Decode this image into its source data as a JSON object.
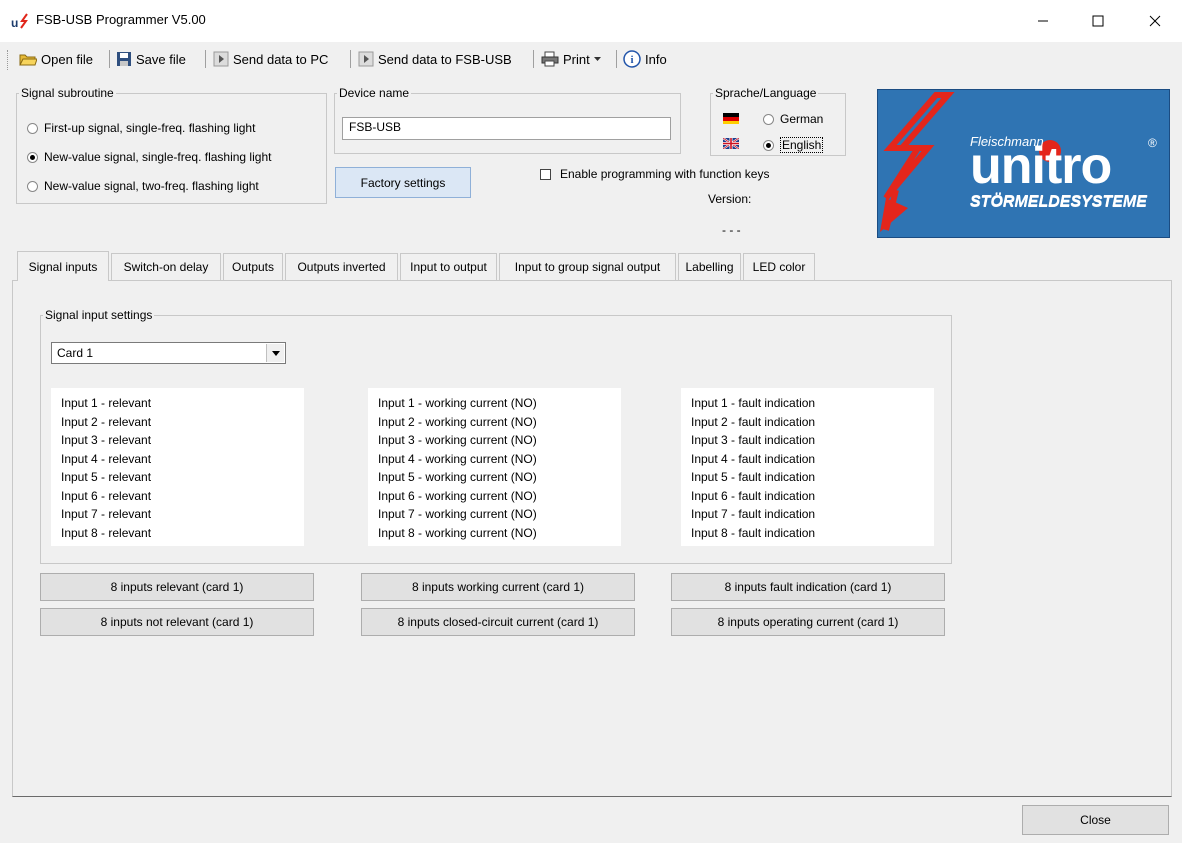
{
  "window": {
    "title": "FSB-USB Programmer V5.00"
  },
  "toolbar": {
    "open_file": "Open file",
    "save_file": "Save file",
    "send_to_pc": "Send data to PC",
    "send_to_device": "Send data to FSB-USB",
    "print": "Print",
    "info": "Info"
  },
  "signal_subroutine": {
    "legend": "Signal subroutine",
    "options": [
      {
        "label": "First-up signal, single-freq. flashing light",
        "checked": false
      },
      {
        "label": "New-value signal, single-freq. flashing light",
        "checked": true
      },
      {
        "label": "New-value signal, two-freq. flashing light",
        "checked": false
      }
    ]
  },
  "device": {
    "legend": "Device name",
    "value": "FSB-USB",
    "factory_button": "Factory settings"
  },
  "language": {
    "legend": "Sprache/Language",
    "german": "German",
    "english": "English",
    "selected": "English"
  },
  "function_keys_label": "Enable programming with function keys",
  "version": {
    "label": "Version:",
    "value": "- - -"
  },
  "logo": {
    "brand_small": "Fleischmann",
    "brand": "unitro",
    "tagline": "STÖRMELDESYSTEME",
    "mark": "®"
  },
  "tabs": [
    "Signal inputs",
    "Switch-on delay",
    "Outputs",
    "Outputs inverted",
    "Input to output",
    "Input to group signal output",
    "Labelling",
    "LED color"
  ],
  "signal_input_settings": {
    "legend": "Signal input settings",
    "card_selected": "Card 1",
    "relevant": [
      "Input 1 - relevant",
      "Input 2 - relevant",
      "Input 3 - relevant",
      "Input 4 - relevant",
      "Input 5 - relevant",
      "Input 6 - relevant",
      "Input 7 - relevant",
      "Input 8 - relevant"
    ],
    "current": [
      "Input 1 - working current (NO)",
      "Input 2 - working current (NO)",
      "Input 3 - working current (NO)",
      "Input 4 - working current (NO)",
      "Input 5 - working current (NO)",
      "Input 6 - working current (NO)",
      "Input 7 - working current (NO)",
      "Input 8 - working current (NO)"
    ],
    "fault": [
      "Input 1 - fault indication",
      "Input 2 - fault indication",
      "Input 3 - fault indication",
      "Input 4 - fault indication",
      "Input 5 - fault indication",
      "Input 6 - fault indication",
      "Input 7 - fault indication",
      "Input 8 - fault indication"
    ]
  },
  "buttons": {
    "all_relevant": "8 inputs relevant (card 1)",
    "all_not_relevant": "8 inputs not relevant (card 1)",
    "all_working": "8 inputs working current (card 1)",
    "all_closed": "8 inputs closed-circuit current (card 1)",
    "all_fault": "8 inputs fault indication (card 1)",
    "all_operating": "8 inputs operating current (card 1)",
    "close": "Close"
  }
}
